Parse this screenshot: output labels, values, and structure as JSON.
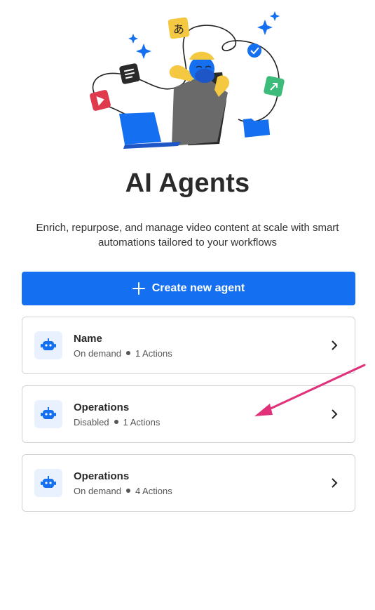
{
  "header": {
    "title": "AI Agents",
    "subtitle": "Enrich, repurpose, and manage video content at scale with smart automations tailored to your workflows",
    "illustration_glyph": "あ"
  },
  "actions": {
    "create_label": "Create new agent"
  },
  "agents": [
    {
      "name": "Name",
      "mode": "On demand",
      "actions": "1 Actions"
    },
    {
      "name": "Operations",
      "mode": "Disabled",
      "actions": "1 Actions"
    },
    {
      "name": "Operations",
      "mode": "On demand",
      "actions": "4 Actions"
    }
  ],
  "colors": {
    "accent": "#1470f0",
    "annotation_arrow": "#e0317a",
    "card_border": "#cfd3d8",
    "icon_bg": "#e8f1fd"
  },
  "icons": {
    "agent": "robot-icon",
    "chevron": "chevron-right-icon",
    "create": "plus-icon"
  }
}
